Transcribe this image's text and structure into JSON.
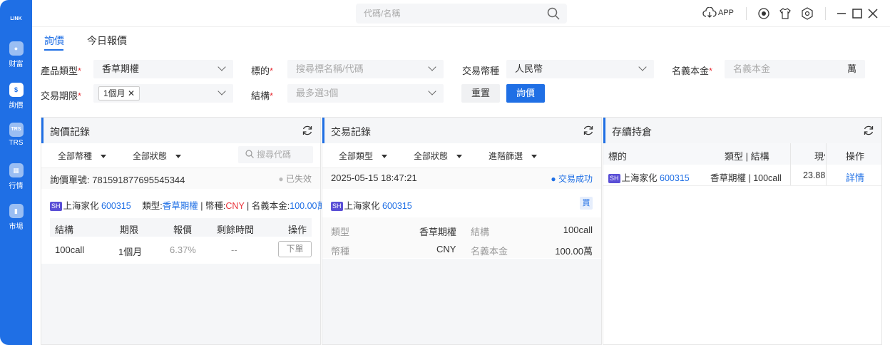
{
  "sidebar": {
    "logo": "LINK",
    "items": [
      {
        "icon": "wealth-icon",
        "label": "财富",
        "glyph": "●"
      },
      {
        "icon": "quote-icon",
        "label": "詢價",
        "glyph": "$"
      },
      {
        "icon": "trs-icon",
        "label": "TRS",
        "glyph": "TRS"
      },
      {
        "icon": "market-icon",
        "label": "行情",
        "glyph": "▦"
      },
      {
        "icon": "chart-icon",
        "label": "市場",
        "glyph": "▮"
      }
    ]
  },
  "topbar": {
    "search_placeholder": "代碼/名稱",
    "app_label": "APP"
  },
  "tabs": [
    "詢價",
    "今日報價"
  ],
  "form": {
    "product_type_label": "產品類型",
    "product_type_value": "香草期權",
    "underlying_label": "標的",
    "underlying_placeholder": "搜尋標名稱/代碼",
    "currency_label": "交易幣種",
    "currency_value": "人民幣",
    "notional_label": "名義本金",
    "notional_placeholder": "名義本金",
    "notional_unit": "萬",
    "term_label": "交易期限",
    "term_tag": "1個月",
    "structure_label": "結構",
    "structure_placeholder": "最多選3個",
    "reset_label": "重置",
    "query_label": "詢價",
    "required_mark": "*"
  },
  "inquiry_panel": {
    "title": "詢價記錄",
    "filter_currency": "全部幣種",
    "filter_status": "全部狀態",
    "search_placeholder": "搜尋代碼",
    "order_no_label": "詢價單號:",
    "order_no": "781591877695545344",
    "status": "已失效",
    "badge": "SH",
    "stock_name": "上海家化",
    "stock_code": "600315",
    "type_label": "類型:",
    "type_value": "香草期權",
    "sep1": " | ",
    "currency_label": "幣種:",
    "currency_value": "CNY",
    "sep2": " | ",
    "notional_label": "名義本金:",
    "notional_value": "100.00萬",
    "columns": [
      "結構",
      "期限",
      "報價",
      "剩餘時間",
      "操作"
    ],
    "row": {
      "structure": "100call",
      "term": "1個月",
      "quote": "6.37%",
      "remaining": "--",
      "action": "下單"
    }
  },
  "trade_panel": {
    "title": "交易記錄",
    "filter_type": "全部類型",
    "filter_status": "全部狀態",
    "filter_advanced": "進階篩選",
    "datetime": "2025-05-15 18:47:21",
    "status": "交易成功",
    "badge": "SH",
    "stock_name": "上海家化",
    "stock_code": "600315",
    "side": "買",
    "type_label": "類型",
    "type_value": "香草期權",
    "structure_label": "結構",
    "structure_value": "100call",
    "currency_label": "幣種",
    "currency_value": "CNY",
    "notional_label": "名義本金",
    "notional_value": "100.00萬"
  },
  "position_panel": {
    "title": "存續持倉",
    "columns": [
      "標的",
      "類型 | 結構",
      "現價",
      "操作"
    ],
    "row": {
      "badge": "SH",
      "stock_name": "上海家化",
      "stock_code": "600315",
      "type_structure": "香草期權 | 100call",
      "price": "23.88",
      "action": "詳情"
    }
  },
  "colors": {
    "accent": "#1f6fe5",
    "required": "#e8333a",
    "badge": "#5a4fd6"
  }
}
